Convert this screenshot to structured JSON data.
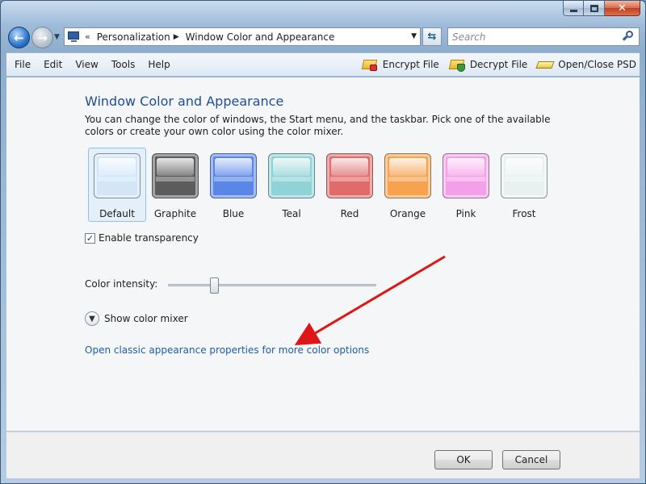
{
  "address_bar": {
    "crumbs": [
      "Personalization",
      "Window Color and Appearance"
    ]
  },
  "search": {
    "placeholder": "Search"
  },
  "menu": {
    "items": [
      "File",
      "Edit",
      "View",
      "Tools",
      "Help"
    ]
  },
  "toolbar": {
    "encrypt": "Encrypt File",
    "decrypt": "Decrypt File",
    "open_close": "Open/Close PSD"
  },
  "content": {
    "title": "Window Color and Appearance",
    "description": "You can change the color of windows, the Start menu, and the taskbar. Pick one of the available colors or create your own color using the color mixer.",
    "swatches": [
      {
        "label": "Default",
        "color": "#d2e6f8",
        "selected": true
      },
      {
        "label": "Graphite",
        "color": "#5c5c5c"
      },
      {
        "label": "Blue",
        "color": "#5a86e6"
      },
      {
        "label": "Teal",
        "color": "#8fd3d6"
      },
      {
        "label": "Red",
        "color": "#e06b6b"
      },
      {
        "label": "Orange",
        "color": "#f6a24f"
      },
      {
        "label": "Pink",
        "color": "#f4a0e8"
      },
      {
        "label": "Frost",
        "color": "#e8f0f0"
      }
    ],
    "transparency_label": "Enable transparency",
    "transparency_checked": true,
    "intensity_label": "Color intensity:",
    "intensity_value": 0.22,
    "mixer_label": "Show color mixer",
    "classic_link": "Open classic appearance properties for more color options"
  },
  "annotation": {
    "color": "#e01515"
  },
  "footer": {
    "ok": "OK",
    "cancel": "Cancel"
  }
}
